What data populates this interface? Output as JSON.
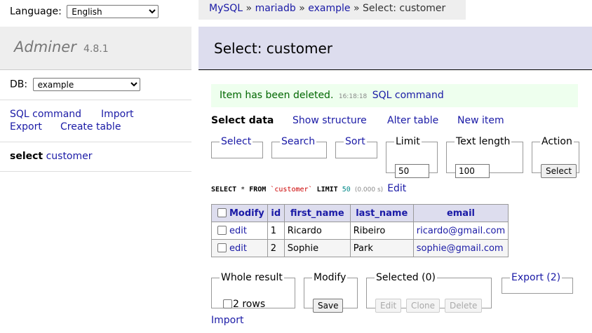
{
  "sidebar": {
    "language_label": "Language:",
    "language_value": "English",
    "brand_name": "Adminer",
    "brand_version": "4.8.1",
    "db_label": "DB:",
    "db_value": "example",
    "links": [
      "SQL command",
      "Import",
      "Export",
      "Create table"
    ],
    "table_link": {
      "action": "select",
      "name": "customer"
    }
  },
  "breadcrumb": {
    "parts": [
      "MySQL",
      "mariadb",
      "example"
    ],
    "sep": "»",
    "current": "Select: customer"
  },
  "header": {
    "title": "Select: customer"
  },
  "message": {
    "text": "Item has been deleted.",
    "time": "16:18:18",
    "link": "SQL command"
  },
  "tabs": [
    {
      "label": "Select data",
      "active": true
    },
    {
      "label": "Show structure"
    },
    {
      "label": "Alter table"
    },
    {
      "label": "New item"
    }
  ],
  "filters": {
    "select": "Select",
    "search": "Search",
    "sort": "Sort",
    "limit_label": "Limit",
    "limit_value": "50",
    "textlen_label": "Text length",
    "textlen_value": "100",
    "action_label": "Action",
    "action_button": "Select"
  },
  "query": {
    "kw1": "SELECT",
    "star": "*",
    "kw2": "FROM",
    "table": "`customer`",
    "kw3": "LIMIT",
    "limit": "50",
    "time": "(0.000 s)",
    "edit": "Edit"
  },
  "table": {
    "headers": [
      "Modify",
      "id",
      "first_name",
      "last_name",
      "email"
    ],
    "rows": [
      {
        "action": "edit",
        "id": "1",
        "first_name": "Ricardo",
        "last_name": "Ribeiro",
        "email": "ricardo@gmail.com"
      },
      {
        "action": "edit",
        "id": "2",
        "first_name": "Sophie",
        "last_name": "Park",
        "email": "sophie@gmail.com"
      }
    ]
  },
  "footer": {
    "whole_result_label": "Whole result",
    "rows_label": "2 rows",
    "modify_label": "Modify",
    "save_button": "Save",
    "selected_label": "Selected (0)",
    "edit_button": "Edit",
    "clone_button": "Clone",
    "delete_button": "Delete",
    "export_label": "Export (2)",
    "import_link": "Import"
  }
}
